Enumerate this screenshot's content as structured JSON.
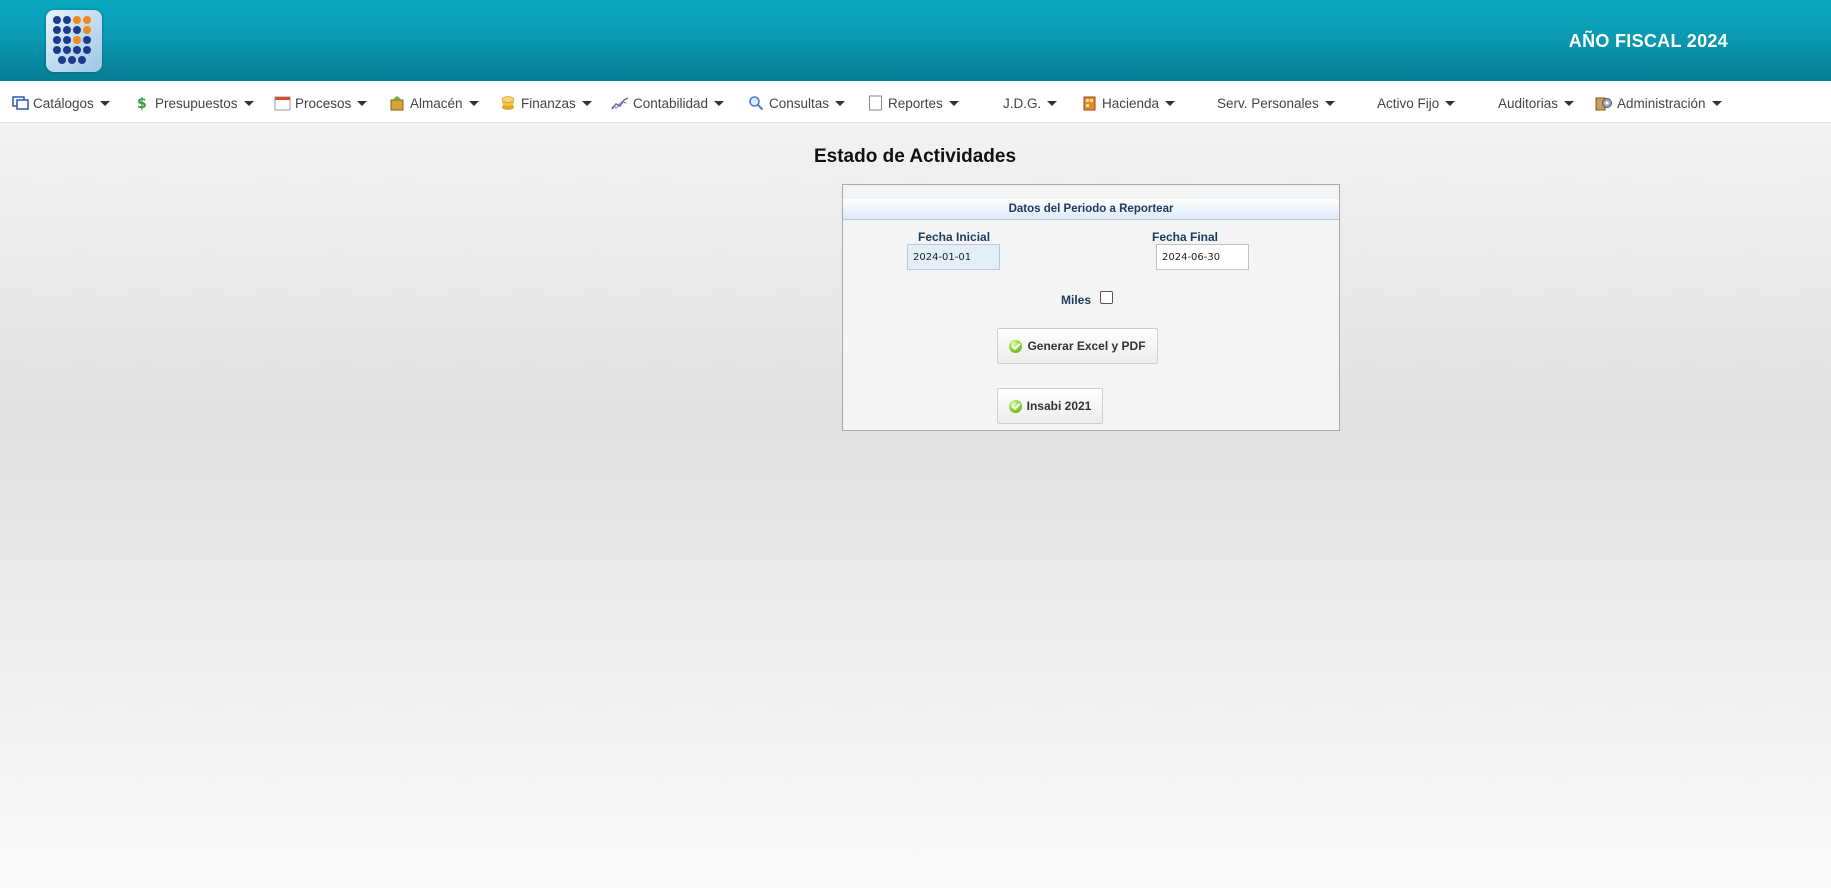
{
  "header": {
    "fiscal_year_label": "AÑO FISCAL  2024"
  },
  "menu": {
    "items": [
      {
        "label": "Catálogos",
        "icon": "catalog-icon"
      },
      {
        "label": "Presupuestos",
        "icon": "money-icon"
      },
      {
        "label": "Procesos",
        "icon": "calendar-icon"
      },
      {
        "label": "Almacén",
        "icon": "box-icon"
      },
      {
        "label": "Finanzas",
        "icon": "coins-icon"
      },
      {
        "label": "Contabilidad",
        "icon": "chart-line-icon"
      },
      {
        "label": "Consultas",
        "icon": "magnifier-icon"
      },
      {
        "label": "Reportes",
        "icon": "report-icon"
      },
      {
        "label": "J.D.G.",
        "icon": ""
      },
      {
        "label": "Hacienda",
        "icon": "building-icon"
      },
      {
        "label": "Serv. Personales",
        "icon": ""
      },
      {
        "label": "Activo Fijo",
        "icon": ""
      },
      {
        "label": "Auditorias",
        "icon": ""
      },
      {
        "label": "Administración",
        "icon": "admin-icon"
      }
    ]
  },
  "page": {
    "title": "Estado de Actividades"
  },
  "form": {
    "panel_title": "Datos del Periodo a Reportear",
    "start_label": "Fecha Inicial",
    "start_value": "2024-01-01",
    "end_label": "Fecha Final",
    "end_value": "2024-06-30",
    "miles_label": "Miles",
    "miles_checked": false,
    "generate_button": "Generar Excel y PDF",
    "insabi_button": "Insabi 2021"
  },
  "colors": {
    "header": "#0a98b1",
    "panel_title_text": "#1f3a5c"
  }
}
